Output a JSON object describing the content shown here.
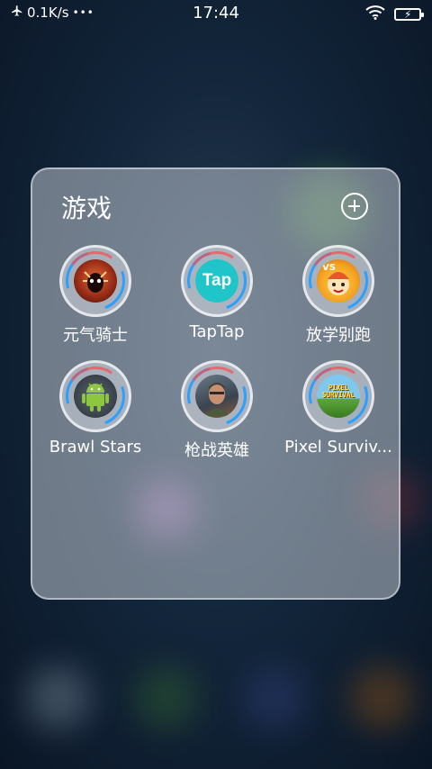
{
  "status_bar": {
    "net_speed": "0.1K/s",
    "more": "•••",
    "time": "17:44"
  },
  "folder": {
    "title": "游戏",
    "apps": [
      {
        "label": "元气骑士",
        "icon": "soul-knight-icon"
      },
      {
        "label": "TapTap",
        "icon": "taptap-icon",
        "icon_text": "Tap"
      },
      {
        "label": "放学别跑",
        "icon": "fangxuebiepao-icon",
        "icon_text": "VS"
      },
      {
        "label": "Brawl Stars",
        "icon": "android-icon"
      },
      {
        "label": "枪战英雄",
        "icon": "soldier-icon"
      },
      {
        "label": "Pixel Surviv...",
        "icon": "pixel-survival-icon",
        "icon_text": "PIXEL SURVIVAL"
      }
    ]
  },
  "colors": {
    "folder_bg": "#bec4ce",
    "accent_blue": "#2aa0ff",
    "taptap": "#1fc5c8",
    "android_green": "#8dc63f"
  }
}
